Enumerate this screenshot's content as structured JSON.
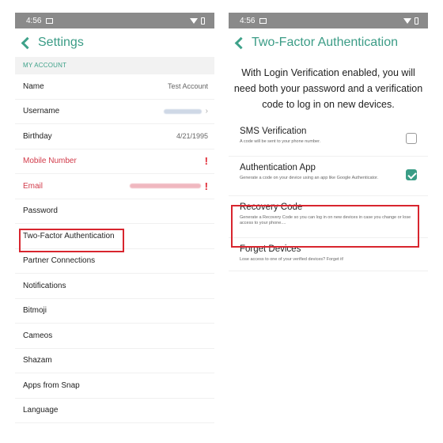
{
  "left": {
    "status_time": "4:56",
    "title": "Settings",
    "section": "MY ACCOUNT",
    "rows": [
      {
        "label": "Name",
        "value": "Test Account"
      },
      {
        "label": "Username",
        "value": ""
      },
      {
        "label": "Birthday",
        "value": "4/21/1995"
      },
      {
        "label": "Mobile Number",
        "value": ""
      },
      {
        "label": "Email",
        "value": ""
      },
      {
        "label": "Password",
        "value": ""
      },
      {
        "label": "Two-Factor Authentication",
        "value": ""
      },
      {
        "label": "Partner Connections",
        "value": ""
      },
      {
        "label": "Notifications",
        "value": ""
      },
      {
        "label": "Bitmoji",
        "value": ""
      },
      {
        "label": "Cameos",
        "value": ""
      },
      {
        "label": "Shazam",
        "value": ""
      },
      {
        "label": "Apps from Snap",
        "value": ""
      },
      {
        "label": "Language",
        "value": ""
      }
    ]
  },
  "right": {
    "status_time": "4:56",
    "title": "Two-Factor Authentication",
    "intro": "With Login Verification enabled, you will need both your password and a verification code to log in on new devices.",
    "options": [
      {
        "title": "SMS Verification",
        "desc": "A code will be sent to your phone number.",
        "checked": false
      },
      {
        "title": "Authentication App",
        "desc": "Generate a code on your device using an app like Google Authenticator.",
        "checked": true
      },
      {
        "title": "Recovery Code",
        "desc": "Generate a Recovery Code so you can log in on new devices in case you change or lose access to your phone....",
        "checked": null
      },
      {
        "title": "Forget Devices",
        "desc": "Lose access to one of your verified devices? Forget it!",
        "checked": null
      }
    ]
  },
  "colors": {
    "accent": "#3b9c86",
    "alert": "#d23b4a",
    "highlight": "#d8252e"
  }
}
